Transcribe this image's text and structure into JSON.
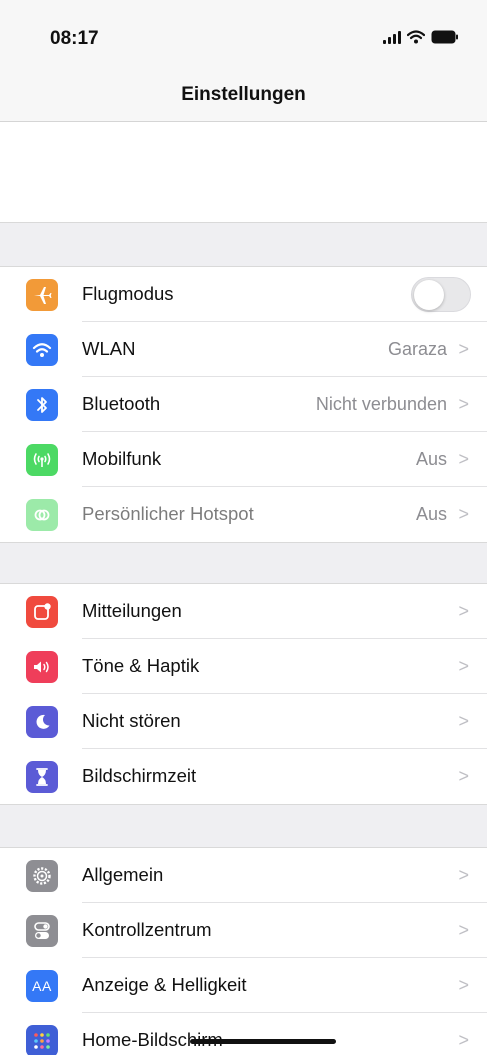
{
  "status_bar": {
    "time": "08:17"
  },
  "nav": {
    "title": "Einstellungen"
  },
  "sections": [
    {
      "rows": [
        {
          "label": "Flugmodus",
          "icon": "airplane-icon",
          "icon_color": "#f29a38",
          "toggle": false
        },
        {
          "label": "WLAN",
          "icon": "wifi-icon",
          "icon_color": "#3478f6",
          "value": "Garaza"
        },
        {
          "label": "Bluetooth",
          "icon": "bluetooth-icon",
          "icon_color": "#3478f6",
          "value": "Nicht verbunden"
        },
        {
          "label": "Mobilfunk",
          "icon": "antenna-icon",
          "icon_color": "#4cd964",
          "value": "Aus"
        },
        {
          "label": "Persönlicher Hotspot",
          "icon": "hotspot-icon",
          "icon_color": "#4cd964",
          "value": "Aus",
          "disabled": true
        }
      ]
    },
    {
      "rows": [
        {
          "label": "Mitteilungen",
          "icon": "notifications-icon",
          "icon_color": "#f04a3e"
        },
        {
          "label": "Töne & Haptik",
          "icon": "speaker-icon",
          "icon_color": "#ef3e5a"
        },
        {
          "label": "Nicht stören",
          "icon": "moon-icon",
          "icon_color": "#5b5bd6"
        },
        {
          "label": "Bildschirmzeit",
          "icon": "hourglass-icon",
          "icon_color": "#5b5bd6"
        }
      ]
    },
    {
      "rows": [
        {
          "label": "Allgemein",
          "icon": "gear-icon",
          "icon_color": "#8e8e93"
        },
        {
          "label": "Kontrollzentrum",
          "icon": "switches-icon",
          "icon_color": "#8e8e93"
        },
        {
          "label": "Anzeige & Helligkeit",
          "icon": "text-size-icon",
          "icon_color": "#3478f6",
          "icon_text": "AA"
        },
        {
          "label": "Home-Bildschirm",
          "icon": "app-grid-icon",
          "icon_color": "#3f5fd6"
        }
      ]
    }
  ],
  "chevron": ">"
}
